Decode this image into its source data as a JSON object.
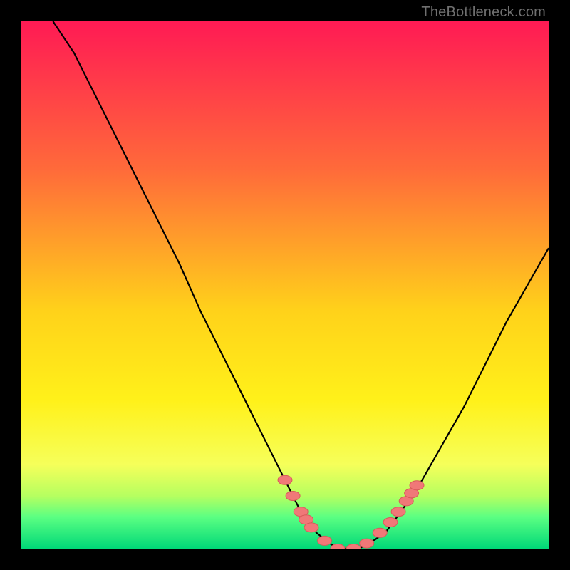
{
  "watermark": "TheBottleneck.com",
  "colors": {
    "bg": "#000000",
    "grad_top": "#ff1a54",
    "grad_upper": "#ff6a3a",
    "grad_mid": "#ffd21a",
    "grad_lower": "#fff11a",
    "grad_light": "#f6ff5a",
    "grad_green1": "#b6ff60",
    "grad_green2": "#5bff82",
    "grad_green3": "#00d878",
    "curve": "#000000",
    "dot_fill": "#f07878",
    "dot_stroke": "#d85a5a"
  },
  "chart_data": {
    "type": "line",
    "title": "",
    "xlabel": "",
    "ylabel": "",
    "xlim": [
      0,
      100
    ],
    "ylim": [
      0,
      100
    ],
    "series": [
      {
        "name": "bottleneck-curve",
        "x": [
          6,
          10,
          14,
          18,
          22,
          26,
          30,
          34,
          38,
          42,
          46,
          50,
          53,
          56,
          58.5,
          60,
          62,
          64,
          66,
          69,
          72,
          76,
          80,
          84,
          88,
          92,
          96,
          100
        ],
        "values": [
          100,
          94,
          86,
          78,
          70,
          62,
          54,
          45,
          37,
          29,
          21,
          13,
          7,
          3,
          1,
          0,
          0,
          0,
          1,
          3,
          7,
          13,
          20,
          27,
          35,
          43,
          50,
          57
        ]
      }
    ],
    "dots": {
      "name": "highlight-dots",
      "x": [
        50,
        51.5,
        53,
        54,
        55,
        57.5,
        60,
        63,
        65.5,
        68,
        70,
        71.5,
        73,
        74,
        75
      ],
      "values": [
        13,
        10,
        7,
        5.5,
        4,
        1.5,
        0,
        0,
        1,
        3,
        5,
        7,
        9,
        10.5,
        12
      ]
    }
  }
}
